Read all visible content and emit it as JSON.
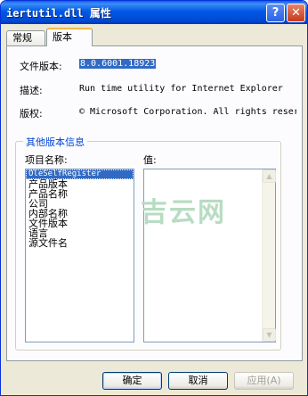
{
  "window": {
    "title": "iertutil.dll 属性",
    "help_glyph": "?",
    "close_glyph": "✕"
  },
  "tabs": [
    {
      "label": "常规",
      "active": false
    },
    {
      "label": "版本",
      "active": true
    }
  ],
  "fields": {
    "file_version_label": "文件版本:",
    "file_version_value": "8.0.6001.18923",
    "description_label": "描述:",
    "description_value": "Run time utility for Internet Explorer",
    "copyright_label": "版权:",
    "copyright_value": "© Microsoft Corporation. All rights reserv"
  },
  "other_info": {
    "group_title": "其他版本信息",
    "item_name_label": "项目名称:",
    "value_label": "值:",
    "items": [
      "OleSelfRegister",
      "产品版本",
      "产品名称",
      "公司",
      "内部名称",
      "文件版本",
      "语言",
      "源文件名"
    ],
    "selected_index": 0
  },
  "watermark": "吉云网",
  "buttons": {
    "ok": "确定",
    "cancel": "取消",
    "apply": "应用(A)"
  },
  "colors": {
    "titlebar": "#0058e6",
    "selection": "#316ac5",
    "group_title": "#0046d5",
    "active_tab_accent": "#f7b64a",
    "watermark": "#b7dcc2"
  }
}
